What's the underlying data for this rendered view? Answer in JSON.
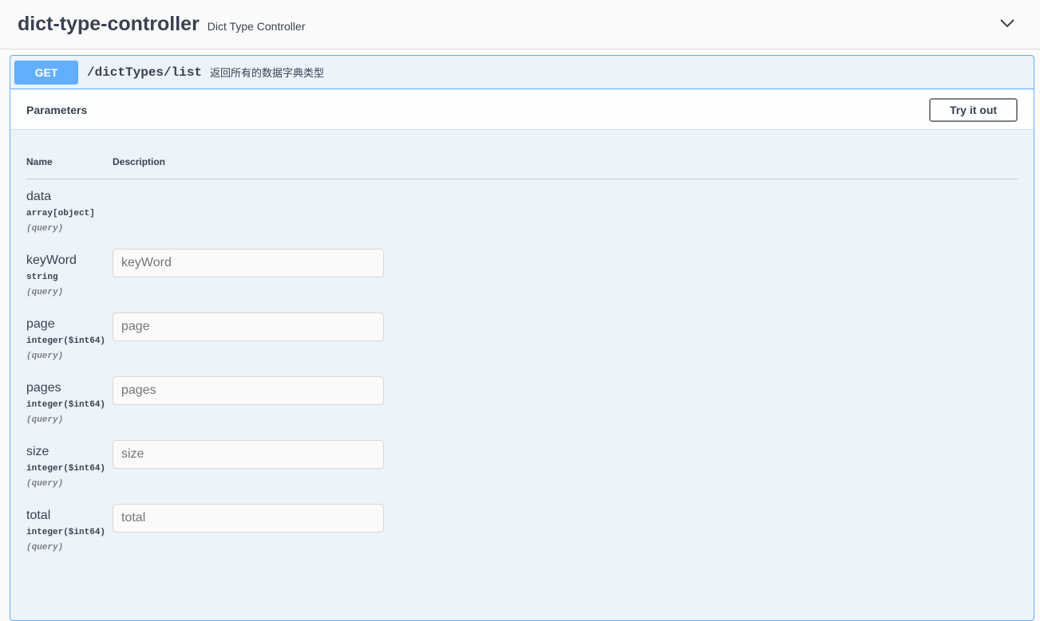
{
  "tag": {
    "name": "dict-type-controller",
    "description": "Dict Type Controller",
    "toggle_icon": "chevron-down-icon"
  },
  "operation": {
    "method": "GET",
    "path": "/dictTypes/list",
    "summary": "返回所有的数据字典类型",
    "accent_color": "#61affe"
  },
  "parameters_section": {
    "title": "Parameters",
    "try_button": "Try it out",
    "columns": {
      "name": "Name",
      "description": "Description"
    }
  },
  "params": [
    {
      "name": "data",
      "type": "array[object]",
      "in": "(query)"
    },
    {
      "name": "keyWord",
      "type": "string",
      "in": "(query)",
      "placeholder": "keyWord"
    },
    {
      "name": "page",
      "type": "integer($int64)",
      "in": "(query)",
      "placeholder": "page"
    },
    {
      "name": "pages",
      "type": "integer($int64)",
      "in": "(query)",
      "placeholder": "pages"
    },
    {
      "name": "size",
      "type": "integer($int64)",
      "in": "(query)",
      "placeholder": "size"
    },
    {
      "name": "total",
      "type": "integer($int64)",
      "in": "(query)",
      "placeholder": "total"
    }
  ]
}
